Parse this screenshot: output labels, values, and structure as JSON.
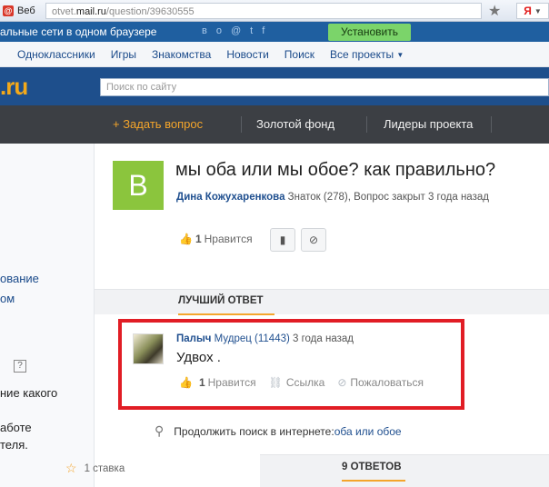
{
  "browser": {
    "tab_title": "Веб",
    "url_prefix": "otvet.",
    "url_host": "mail.ru",
    "url_path": "/question/39630555",
    "ya_label": "Я"
  },
  "promo": {
    "text": "альные сети в одном браузере",
    "install_label": "Установить"
  },
  "portal_nav": {
    "items": [
      "Одноклассники",
      "Игры",
      "Знакомства",
      "Новости",
      "Поиск",
      "Все проекты"
    ]
  },
  "logo": {
    "text": ".ru"
  },
  "search": {
    "placeholder": "Поиск по сайту"
  },
  "main_nav": {
    "ask": "+ Задать вопрос",
    "gold": "Золотой фонд",
    "leaders": "Лидеры проекта"
  },
  "sidebar": {
    "link1": "ование",
    "link2": "ом",
    "lines": [
      "ние какого",
      "аботе",
      "теля."
    ]
  },
  "question": {
    "avatar_letter": "В",
    "title": "мы оба или мы обое? как правильно?",
    "author": "Дина Кожухаренкова",
    "meta": " Знаток (278), Вопрос закрыт 3 года назад",
    "likes": "1",
    "like_label": "Нравится"
  },
  "best_answer": {
    "section_label": "ЛУЧШИЙ ОТВЕТ",
    "author": "Палыч",
    "rank": " Мудрец (11443)",
    "time": " 3 года назад",
    "text": "Удвох .",
    "likes": "1",
    "like_label": "Нравится",
    "link_label": "Ссылка",
    "report_label": "Пожаловаться"
  },
  "continue_search": {
    "text": "Продолжить поиск в интернете: ",
    "query": "оба или обое"
  },
  "stake": {
    "text": "1 ставка"
  },
  "answers_tab": {
    "label": "9 ОТВЕТОВ"
  },
  "colors": {
    "highlight": "#e11d25",
    "accent": "#f4a52b",
    "link": "#1f4f8f"
  }
}
